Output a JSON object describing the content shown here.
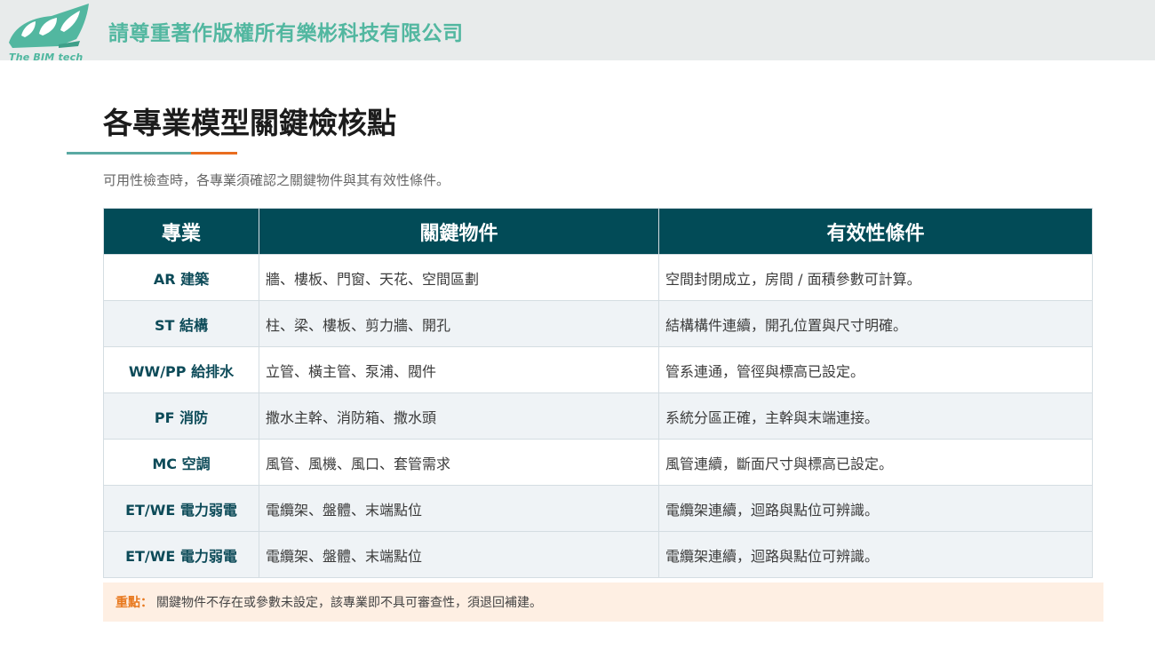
{
  "header": {
    "logo_text": "The BIM tech",
    "copyright": "請尊重著作版權所有樂彬科技有限公司"
  },
  "page": {
    "title": "各專業模型關鍵檢核點",
    "subtitle": "可用性檢查時，各專業須確認之關鍵物件與其有效性條件。"
  },
  "table": {
    "headers": [
      "專業",
      "關鍵物件",
      "有效性條件"
    ],
    "rows": [
      {
        "discipline": "AR  建築",
        "objects": "牆、樓板、門窗、天花、空間區劃",
        "condition": "空間封閉成立，房間 / 面積參數可計算。"
      },
      {
        "discipline": "ST  結構",
        "objects": "柱、梁、樓板、剪力牆、開孔",
        "condition": "結構構件連續，開孔位置與尺寸明確。"
      },
      {
        "discipline": "WW/PP  給排水",
        "objects": "立管、橫主管、泵浦、閥件",
        "condition": "管系連通，管徑與標高已設定。"
      },
      {
        "discipline": "PF  消防",
        "objects": "撒水主幹、消防箱、撒水頭",
        "condition": "系統分區正確，主幹與末端連接。"
      },
      {
        "discipline": "MC  空調",
        "objects": "風管、風機、風口、套管需求",
        "condition": "風管連續，斷面尺寸與標高已設定。"
      },
      {
        "discipline": "ET/WE  電力弱電",
        "objects": "電纜架、盤體、末端點位",
        "condition": "電纜架連續，迴路與點位可辨識。"
      },
      {
        "discipline": "ET/WE  電力弱電",
        "objects": "電纜架、盤體、末端點位",
        "condition": "電纜架連續，迴路與點位可辨識。"
      }
    ]
  },
  "note": {
    "label": "重點：",
    "text": "關鍵物件不存在或參數未設定，該專業即不具可審查性，須退回補建。"
  },
  "colors": {
    "brand_teal": "#52b7a0",
    "header_dark_teal": "#024b57",
    "accent_orange": "#e96d1f",
    "note_background": "#feefe3"
  }
}
